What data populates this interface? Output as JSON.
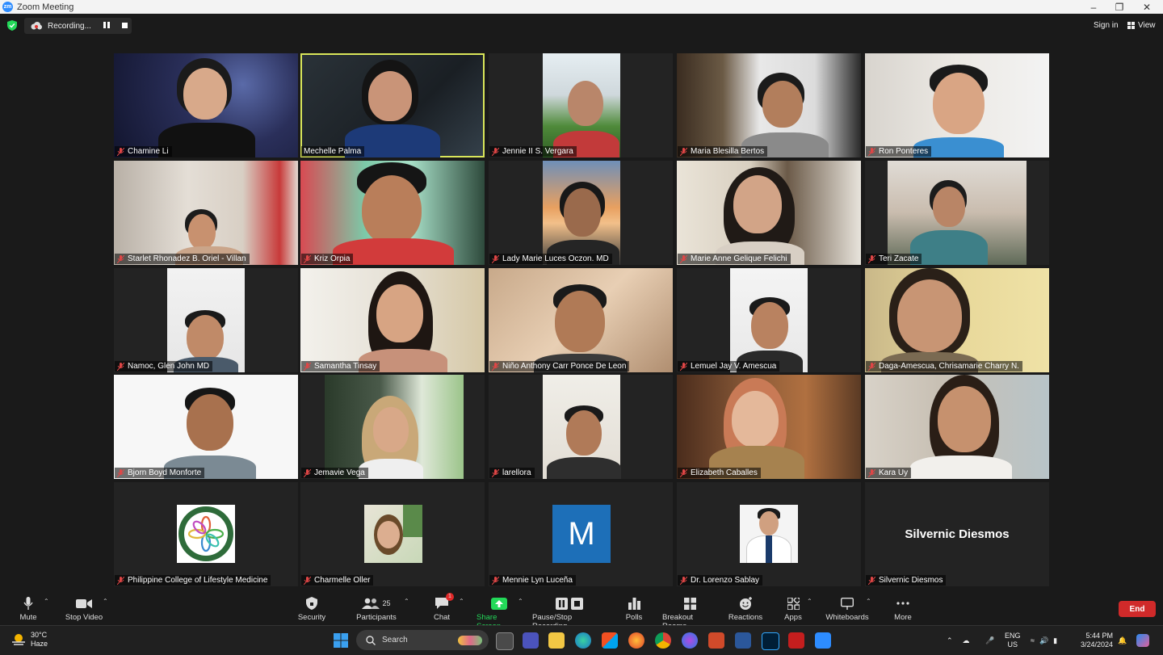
{
  "window": {
    "title": "Zoom Meeting",
    "logo": "zm"
  },
  "topbar": {
    "recording_label": "Recording...",
    "signin_label": "Sign in",
    "view_label": "View"
  },
  "gallery": {
    "tiles": [
      {
        "name": "Chamine Li"
      },
      {
        "name": "Mechelle Palma",
        "active": true
      },
      {
        "name": "Jennie II S. Vergara"
      },
      {
        "name": "Maria Blesilla Bertos"
      },
      {
        "name": "Ron Ponteres"
      },
      {
        "name": "Starlet Rhonadez B. Oriel - Villan"
      },
      {
        "name": "Kriz Orpia"
      },
      {
        "name": "Lady Marie Luces Oczon. MD"
      },
      {
        "name": "Marie Anne Gelique Felichi"
      },
      {
        "name": "Teri Zacate"
      },
      {
        "name": "Namoc, Glen John MD"
      },
      {
        "name": "Samantha Tinsay"
      },
      {
        "name": "Niño Anthony Carr Ponce De Leon"
      },
      {
        "name": "Lemuel Jay V. Amescua"
      },
      {
        "name": "Daga-Amescua, Chrisamarie Charry N."
      },
      {
        "name": "Bjorn Boyd Monforte"
      },
      {
        "name": "Jemavie Vega"
      },
      {
        "name": "larellora"
      },
      {
        "name": "Elizabeth Caballes"
      },
      {
        "name": "Kara Uy"
      },
      {
        "name": "Philippine College of Lifestyle Medicine"
      },
      {
        "name": "Charmelle Oller"
      },
      {
        "name": "Mennie Lyn Luceña",
        "initial": "M"
      },
      {
        "name": "Dr. Lorenzo Sablay"
      },
      {
        "name": "Silvernic Diesmos",
        "display_name": "Silvernic Diesmos"
      }
    ]
  },
  "toolbar": {
    "mute": "Mute",
    "stop_video": "Stop Video",
    "security": "Security",
    "participants": "Participants",
    "participants_count": "25",
    "chat": "Chat",
    "chat_badge": "1",
    "share_screen": "Share Screen",
    "pause_stop_recording": "Pause/Stop Recording",
    "polls": "Polls",
    "breakout_rooms": "Breakout Rooms",
    "reactions": "Reactions",
    "apps": "Apps",
    "whiteboards": "Whiteboards",
    "more": "More",
    "end": "End"
  },
  "taskbar": {
    "temperature": "30°C",
    "weather": "Haze",
    "search_placeholder": "Search",
    "lang_line1": "ENG",
    "lang_line2": "US",
    "time": "5:44 PM",
    "date": "3/24/2024"
  },
  "colors": {
    "active_speaker": "#d9e65a",
    "end_button": "#d02a2a",
    "share_screen": "#23d959",
    "zoom_blue": "#2d8cff"
  }
}
